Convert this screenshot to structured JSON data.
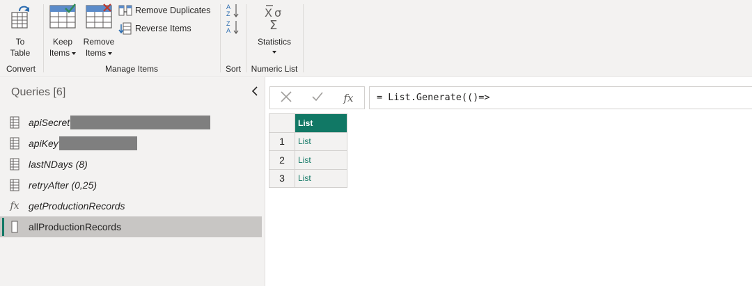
{
  "ribbon": {
    "convert": {
      "to_table_line1": "To",
      "to_table_line2": "Table",
      "group_label": "Convert"
    },
    "manage_items": {
      "keep_items_line1": "Keep",
      "keep_items_line2": "Items",
      "remove_items_line1": "Remove",
      "remove_items_line2": "Items",
      "remove_duplicates": "Remove Duplicates",
      "reverse_items": "Reverse Items",
      "group_label": "Manage Items"
    },
    "sort": {
      "group_label": "Sort"
    },
    "numeric_list": {
      "statistics": "Statistics",
      "group_label": "Numeric List"
    }
  },
  "queries": {
    "header": "Queries [6]",
    "items": [
      {
        "name": "apiSecret",
        "icon": "parameter-icon",
        "redacted": true
      },
      {
        "name": "apiKey",
        "icon": "parameter-icon",
        "redacted": true
      },
      {
        "name": "lastNDays (8)",
        "icon": "parameter-icon"
      },
      {
        "name": "retryAfter (0,25)",
        "icon": "parameter-icon"
      },
      {
        "name": "getProductionRecords",
        "icon": "function-icon"
      },
      {
        "name": "allProductionRecords",
        "icon": "list-query-icon",
        "selected": true
      }
    ]
  },
  "formula_bar": {
    "fx_label": "fx",
    "formula": "= List.Generate(()=>"
  },
  "grid": {
    "column_header": "List",
    "rows": [
      {
        "num": "1",
        "value": "List"
      },
      {
        "num": "2",
        "value": "List"
      },
      {
        "num": "3",
        "value": "List"
      }
    ]
  },
  "colors": {
    "accent": "#117865",
    "ribbon_bg": "#f3f2f1",
    "selected_bg": "#c8c6c4",
    "redaction": "#7f7f7f"
  }
}
